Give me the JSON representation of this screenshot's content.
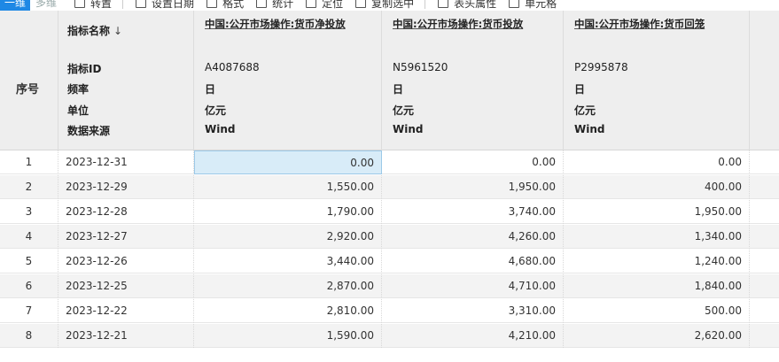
{
  "toolbar": {
    "seg_active": "一维",
    "seg_inactive": "多维",
    "items": [
      "转置",
      "设置日期",
      "格式",
      "统计",
      "定位",
      "复制选中",
      "表头属性",
      "单元格"
    ]
  },
  "header": {
    "index_label": "序号",
    "meta_labels": [
      "指标名称",
      "指标ID",
      "频率",
      "单位",
      "数据来源"
    ],
    "sort_icon": "↓",
    "columns": [
      {
        "name": "中国:公开市场操作:货币净投放",
        "id": "A4087688",
        "freq": "日",
        "unit": "亿元",
        "source": "Wind"
      },
      {
        "name": "中国:公开市场操作:货币投放",
        "id": "N5961520",
        "freq": "日",
        "unit": "亿元",
        "source": "Wind"
      },
      {
        "name": "中国:公开市场操作:货币回笼",
        "id": "P2995878",
        "freq": "日",
        "unit": "亿元",
        "source": "Wind"
      }
    ]
  },
  "rows": [
    {
      "idx": "1",
      "date": "2023-12-31",
      "a": "0.00",
      "b": "0.00",
      "c": "0.00"
    },
    {
      "idx": "2",
      "date": "2023-12-29",
      "a": "1,550.00",
      "b": "1,950.00",
      "c": "400.00"
    },
    {
      "idx": "3",
      "date": "2023-12-28",
      "a": "1,790.00",
      "b": "3,740.00",
      "c": "1,950.00"
    },
    {
      "idx": "4",
      "date": "2023-12-27",
      "a": "2,920.00",
      "b": "4,260.00",
      "c": "1,340.00"
    },
    {
      "idx": "5",
      "date": "2023-12-26",
      "a": "3,440.00",
      "b": "4,680.00",
      "c": "1,240.00"
    },
    {
      "idx": "6",
      "date": "2023-12-25",
      "a": "2,870.00",
      "b": "4,710.00",
      "c": "1,840.00"
    },
    {
      "idx": "7",
      "date": "2023-12-22",
      "a": "2,810.00",
      "b": "3,310.00",
      "c": "500.00"
    },
    {
      "idx": "8",
      "date": "2023-12-21",
      "a": "1,590.00",
      "b": "4,210.00",
      "c": "2,620.00"
    }
  ]
}
